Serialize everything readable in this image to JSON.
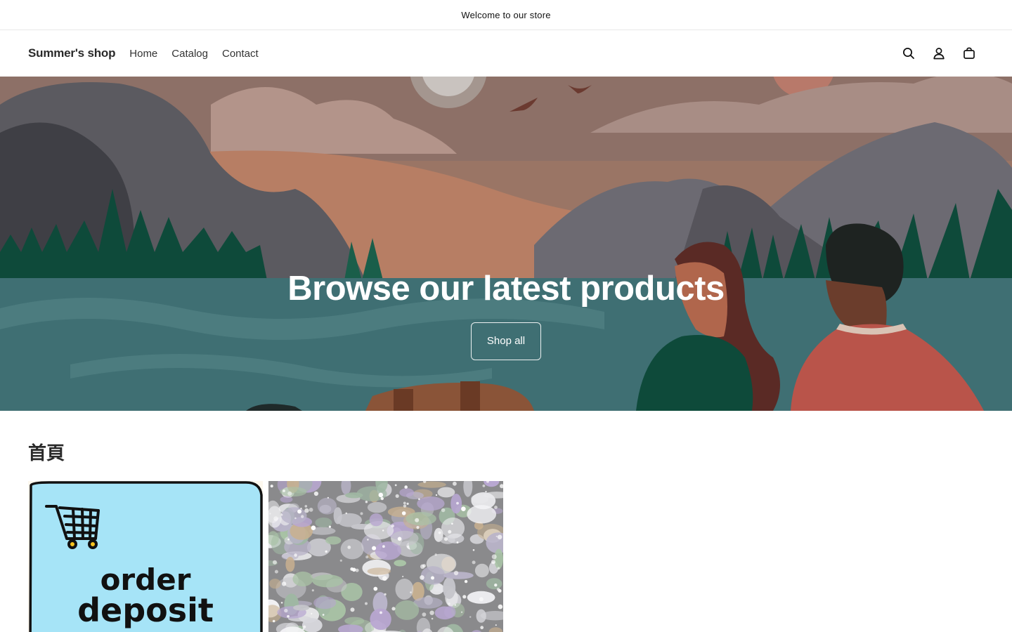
{
  "announcement": {
    "text": "Welcome to our store"
  },
  "header": {
    "logo": "Summer's shop",
    "nav": [
      {
        "label": "Home"
      },
      {
        "label": "Catalog"
      },
      {
        "label": "Contact"
      }
    ],
    "icons": [
      "search-icon",
      "account-icon",
      "cart-icon"
    ]
  },
  "hero": {
    "title": "Browse our latest products",
    "button_label": "Shop all"
  },
  "collection": {
    "title": "首頁",
    "products": [
      {
        "image_text_line1": "order",
        "image_text_line2": "deposit",
        "icon": "shopping-cart-icon"
      },
      {
        "icon": "jewelry-photo"
      }
    ]
  },
  "colors": {
    "accent_text": "#121212",
    "hero_water": "#3f6f73",
    "card_blue": "#a6e4f7"
  }
}
